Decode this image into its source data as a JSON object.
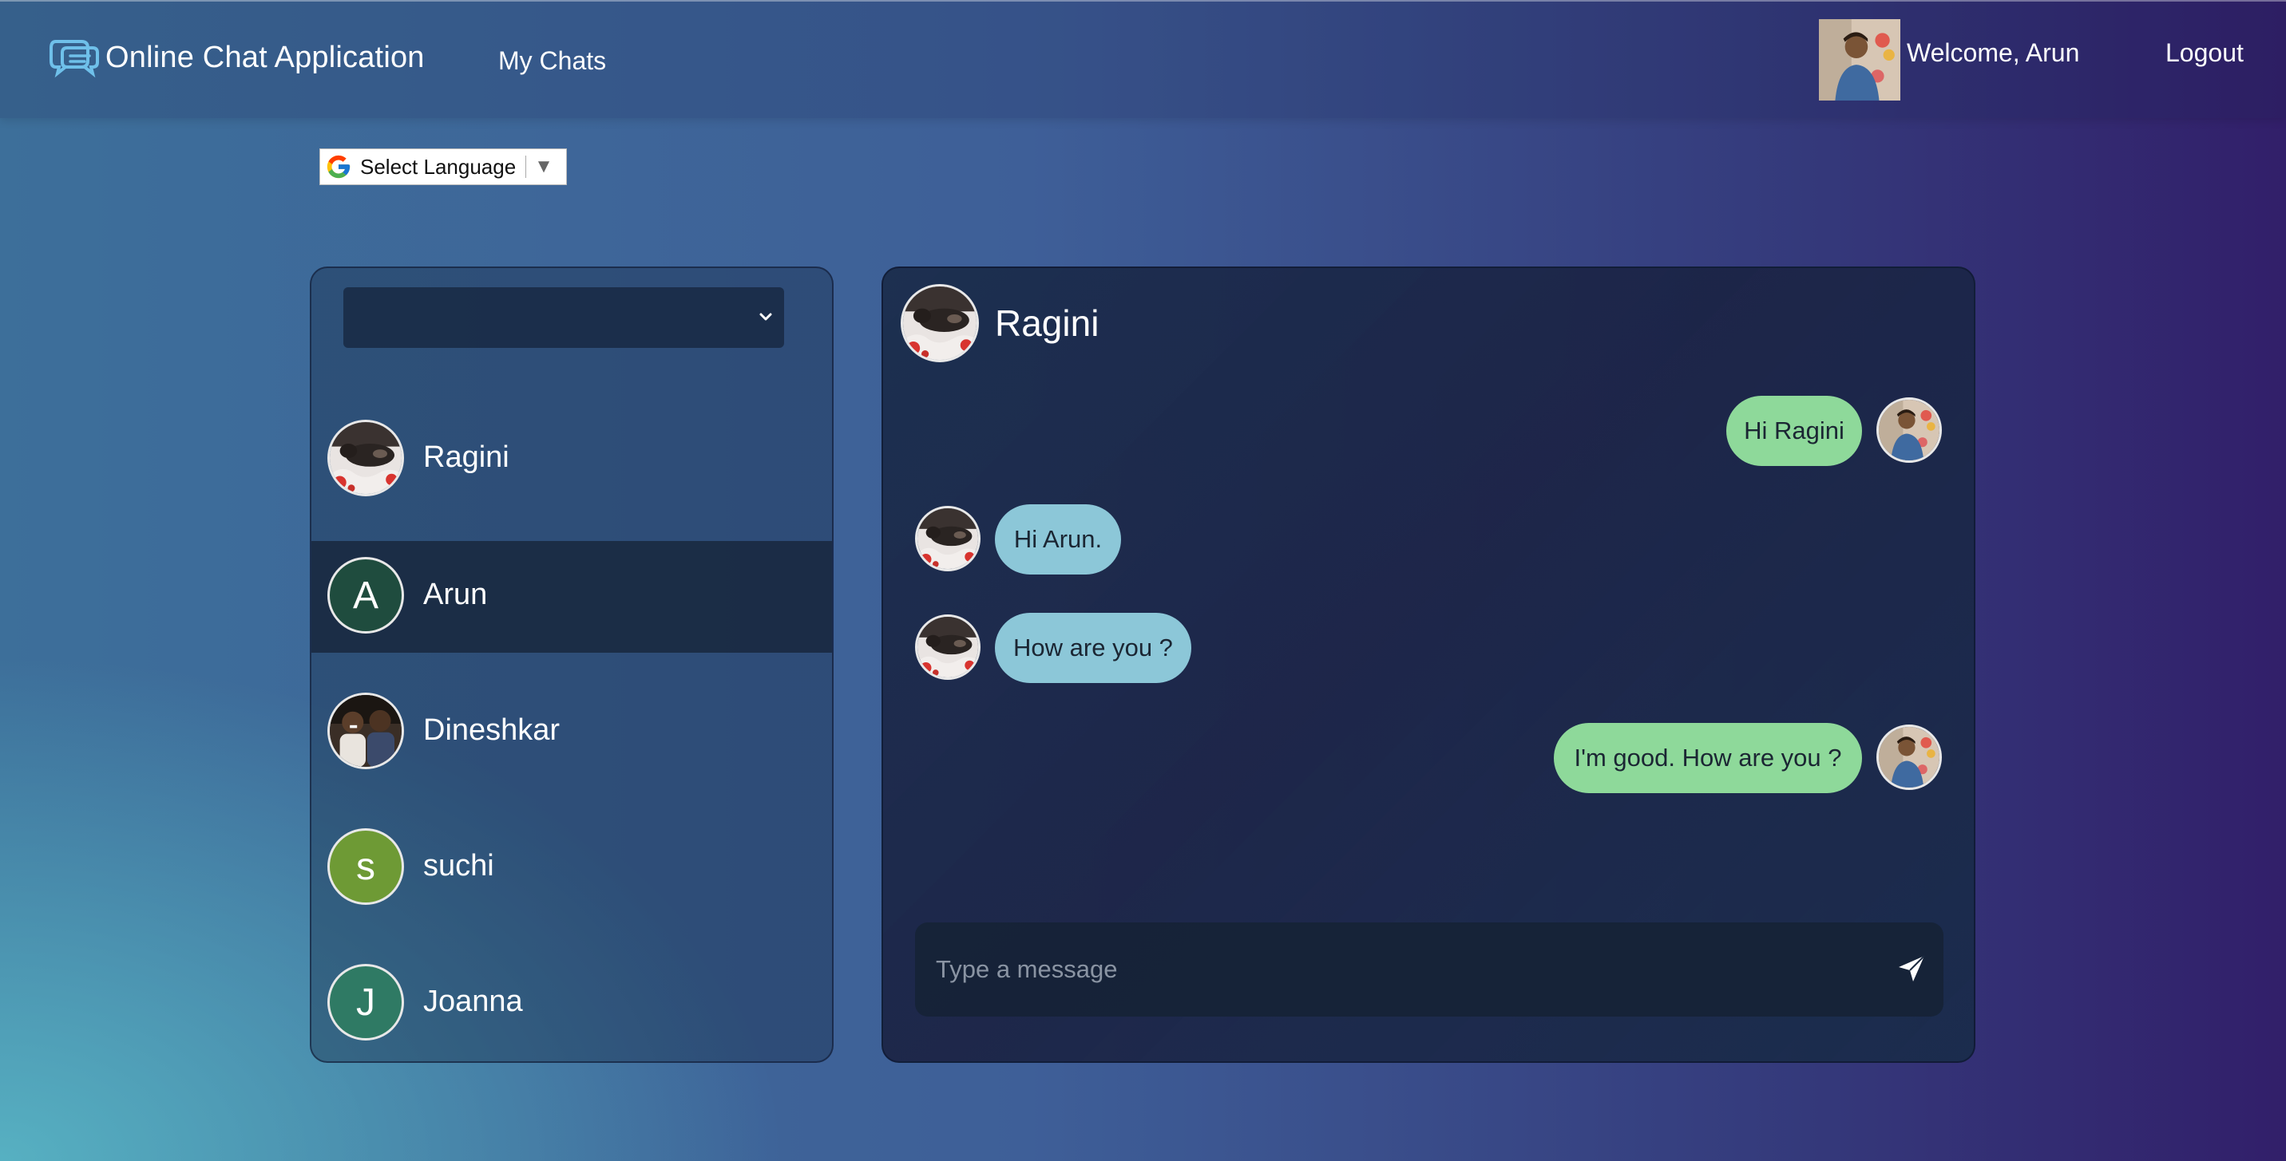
{
  "app": {
    "title": "Online Chat Application",
    "brand_color": "#5fb4e0"
  },
  "nav": {
    "my_chats": "My Chats",
    "welcome": "Welcome, Arun",
    "logout": "Logout"
  },
  "language": {
    "label": "Select Language",
    "arrow": "▼"
  },
  "contacts": [
    {
      "name": "Ragini",
      "type": "photo",
      "icon": "cat-photo-avatar",
      "active": false
    },
    {
      "name": "Arun",
      "type": "initial",
      "initial": "A",
      "color": "#1f4c3e",
      "active": true
    },
    {
      "name": "Dineshkar",
      "type": "photo",
      "icon": "group-photo-avatar",
      "active": false
    },
    {
      "name": "suchi",
      "type": "initial",
      "initial": "s",
      "color": "#6e9a35",
      "active": false
    },
    {
      "name": "Joanna",
      "type": "initial",
      "initial": "J",
      "color": "#2f7a64",
      "active": false
    }
  ],
  "chat": {
    "contact_name": "Ragini",
    "messages": [
      {
        "text": "Hi Ragini",
        "direction": "sent"
      },
      {
        "text": "Hi Arun.",
        "direction": "received"
      },
      {
        "text": "How are you ?",
        "direction": "received"
      },
      {
        "text": "I'm good. How are you ?",
        "direction": "sent"
      }
    ],
    "input": {
      "placeholder": "Type a message",
      "value": ""
    }
  },
  "colors": {
    "sent_bubble": "#8ed99a",
    "received_bubble": "#8cc7d8"
  }
}
